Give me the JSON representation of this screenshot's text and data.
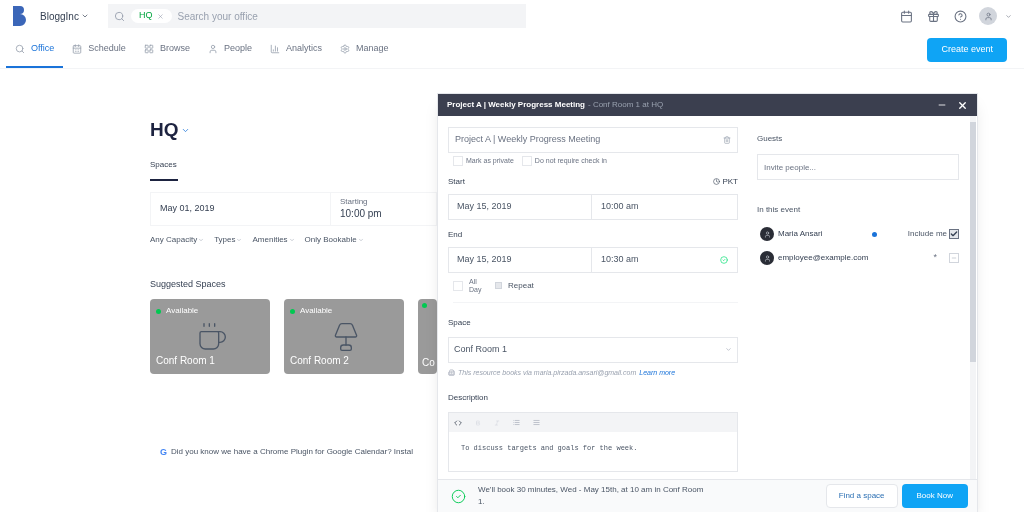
{
  "header": {
    "company": "BloggInc",
    "search": {
      "chip": "HQ",
      "placeholder": "Search your office"
    }
  },
  "nav": [
    {
      "label": "Office",
      "selected": true
    },
    {
      "label": "Schedule",
      "selected": false
    },
    {
      "label": "Browse",
      "selected": false
    },
    {
      "label": "People",
      "selected": false
    },
    {
      "label": "Analytics",
      "selected": false
    },
    {
      "label": "Manage",
      "selected": false
    }
  ],
  "create_button": "Create event",
  "office": {
    "title": "HQ",
    "tabs": [
      {
        "label": "Spaces",
        "selected": true
      }
    ],
    "date": "May 01, 2019",
    "starting_label": "Starting",
    "starting_time": "10:00 pm",
    "filters": [
      "Any Capacity",
      "Types",
      "Amenities",
      "Only Bookable"
    ],
    "suggested_title": "Suggested Spaces",
    "spaces": [
      {
        "name": "Conf Room 1",
        "status": "Available"
      },
      {
        "name": "Conf Room 2",
        "status": "Available"
      },
      {
        "name": "Co"
      }
    ],
    "tip_logo": "G",
    "tip": "Did you know we have a Chrome Plugin for Google Calendar? Instal"
  },
  "dialog": {
    "title": "Project A | Weekly Progress Meeting",
    "subtitle": "- Conf Room 1 at  HQ",
    "event_name": "Project A | Weekly Progress Meeting",
    "options": [
      {
        "label": "Mark as private",
        "checked": false
      },
      {
        "label": "Do not require check in",
        "checked": false
      }
    ],
    "start_label": "Start",
    "timezone": "PKT",
    "start_date": "May 15, 2019",
    "start_time": "10:00 am",
    "end_label": "End",
    "end_date": "May 15, 2019",
    "end_time": "10:30 am",
    "all_day": {
      "label": "All Day",
      "checked": false
    },
    "repeat": {
      "label": "Repeat",
      "checked": false
    },
    "space_label": "Space",
    "space": "Conf Room 1",
    "resource_note": "This resource books via maria.pirzada.ansari@gmail.com",
    "learn_more": "Learn more",
    "description_label": "Description",
    "description": "To discuss targets and goals for the week.",
    "guests_label": "Guests",
    "guests_placeholder": "Invite people...",
    "in_event_label": "In this event",
    "people": [
      {
        "kind": "organizer",
        "name": "Maria Ansari",
        "color": "#1a73d9",
        "include_label": "Include me",
        "checked": true
      },
      {
        "kind": "guest",
        "name": "employee@example.com",
        "mark": "*"
      }
    ],
    "footer_message": "We'll book 30 minutes, Wed - May 15th, at 10 am in Conf Room 1.",
    "find_button": "Find a space",
    "book_button": "Book Now"
  }
}
